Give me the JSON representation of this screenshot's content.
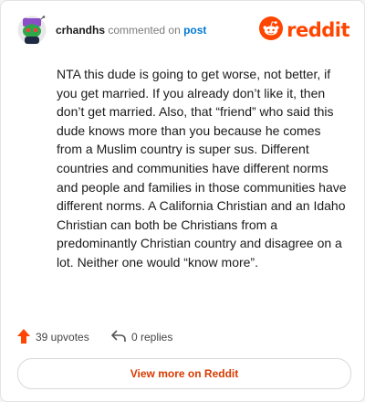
{
  "header": {
    "username": "crhandhs",
    "connector": "commented on",
    "post_link": "post",
    "brand": "reddit",
    "avatar_icon": "snoo-avatar-icon",
    "brand_icon": "reddit-logo-icon"
  },
  "comment": {
    "paragraphs": [
      "NTA this dude is going to get worse, not better, if you get married. If you already don’t like it, then don’t get married. Also, that “friend” who said this dude knows more than you because he comes from a Muslim country is super sus. Different countries and communities have different norms and people and families in those communities have different norms. A California Christian and an Idaho Christian can both be Christians from a predominantly Christian country and disagree on a lot. Neither one would “know more”."
    ]
  },
  "footer": {
    "upvotes": "39 upvotes",
    "replies": "0 replies",
    "upvote_icon": "upvote-arrow-icon",
    "reply_icon": "reply-arrow-icon"
  },
  "cta": {
    "label": "View more on Reddit"
  },
  "colors": {
    "brand": "#ff4500",
    "link": "#0079d3",
    "cta_text": "#d93a00",
    "avatar_green": "#2ea64a",
    "avatar_purple": "#8a4fc7"
  }
}
